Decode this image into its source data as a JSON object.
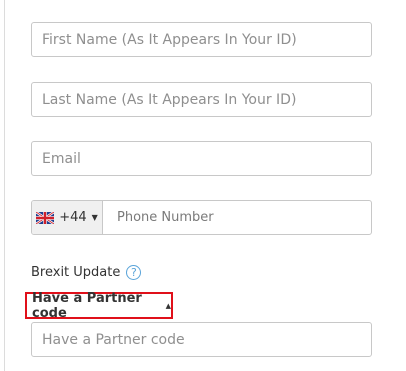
{
  "form": {
    "first_name": {
      "placeholder": "First Name (As It Appears In Your ID)",
      "value": ""
    },
    "last_name": {
      "placeholder": "Last Name (As It Appears In Your ID)",
      "value": ""
    },
    "email": {
      "placeholder": "Email",
      "value": ""
    },
    "phone": {
      "country_icon": "uk-flag-icon",
      "dial_code": "+44",
      "placeholder": "Phone Number",
      "value": ""
    },
    "brexit": {
      "label": "Brexit Update",
      "help_symbol": "?"
    },
    "partner": {
      "toggle_label": "Have a Partner code",
      "placeholder": "Have a Partner code",
      "value": ""
    }
  },
  "colors": {
    "highlight_border": "#e0101a",
    "help_icon": "#5aa4d9"
  }
}
